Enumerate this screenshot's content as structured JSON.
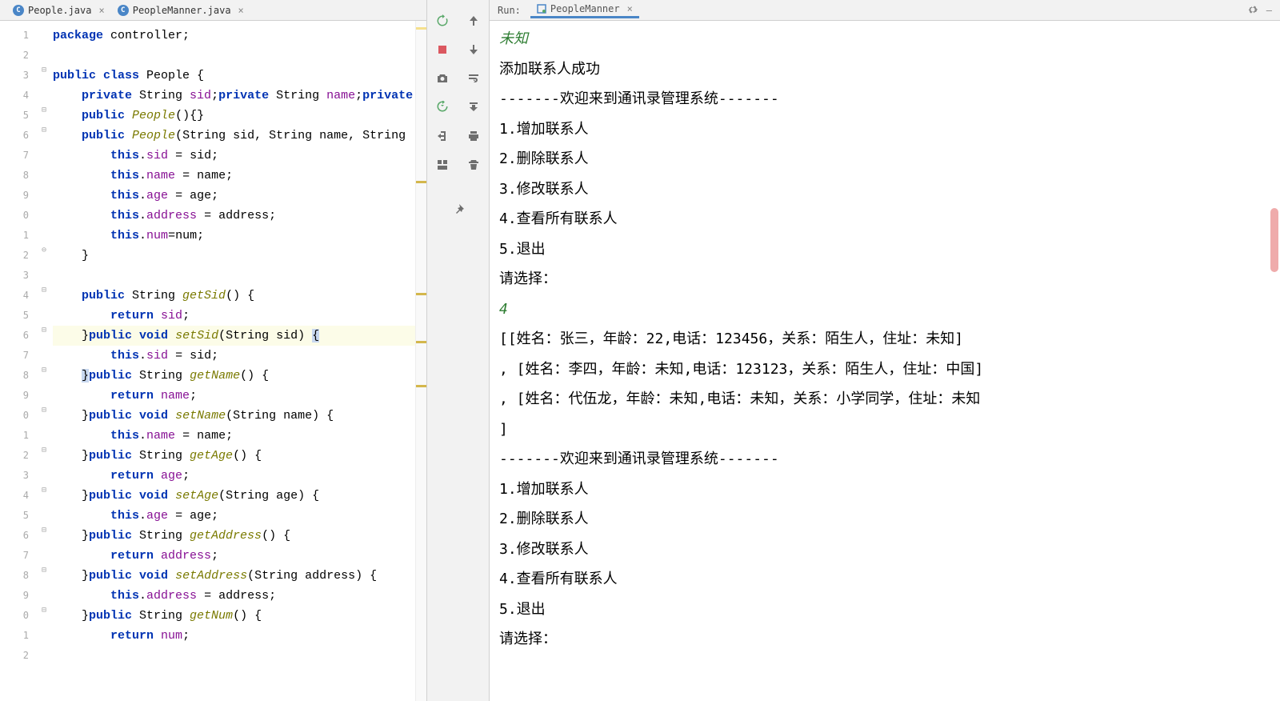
{
  "editor": {
    "tabs": [
      {
        "label": "People.java"
      },
      {
        "label": "PeopleManner.java"
      }
    ],
    "gutter": [
      "1",
      "2",
      "3",
      "4",
      "5",
      "6",
      "7",
      "8",
      "9",
      "0",
      "1",
      "2",
      "3",
      "4",
      "5",
      "6",
      "7",
      "8",
      "9",
      "0",
      "1",
      "2",
      "3",
      "4",
      "5",
      "6",
      "7",
      "8",
      "9",
      "0",
      "1",
      "2"
    ],
    "code_tokens": {
      "l1": {
        "kw1": "package",
        "plain": " controller;"
      },
      "l3": {
        "kw1": "public",
        "kw2": "class",
        "plain": " People {"
      },
      "l4": {
        "kw1": "private",
        "t1": " String ",
        "f1": "sid",
        "s1": ";",
        "kw2": "private",
        "t2": " String ",
        "f2": "name",
        "s2": ";",
        "kw3": "private"
      },
      "l5": {
        "kw1": "public",
        "m": "People",
        "plain": "(){}"
      },
      "l6": {
        "kw1": "public",
        "m": "People",
        "params": "(String sid, String name, String"
      },
      "l7": {
        "kw": "this",
        "f": "sid",
        "plain": " = sid;"
      },
      "l8": {
        "kw": "this",
        "f": "name",
        "plain": " = name;"
      },
      "l9": {
        "kw": "this",
        "f": "age",
        "plain": " = age;"
      },
      "l10": {
        "kw": "this",
        "f": "address",
        "plain": " = address;"
      },
      "l11": {
        "kw": "this",
        "f": "num",
        "plain": "=num;"
      },
      "l12": {
        "plain": "}"
      },
      "l14": {
        "kw1": "public",
        "t": " String ",
        "m": "getSid",
        "plain": "() {"
      },
      "l15": {
        "kw": "return",
        "f": "sid",
        "plain": ";"
      },
      "l16a": {
        "plain1": "}",
        "kw1": "public",
        "kw2": "void",
        "m": "setSid",
        "params": "(String sid) ",
        "brace": "{"
      },
      "l17": {
        "kw": "this",
        "f": "sid",
        "plain": " = sid;"
      },
      "l18": {
        "brace": "}",
        "kw1": "public",
        "t": " String ",
        "m": "getName",
        "plain": "() {"
      },
      "l19": {
        "kw": "return",
        "f": "name",
        "plain": ";"
      },
      "l20": {
        "plain1": "}",
        "kw1": "public",
        "kw2": "void",
        "m": "setName",
        "params": "(String name) {"
      },
      "l21": {
        "kw": "this",
        "f": "name",
        "plain": " = name;"
      },
      "l22": {
        "plain1": "}",
        "kw1": "public",
        "t": " String ",
        "m": "getAge",
        "plain": "() {"
      },
      "l23": {
        "kw": "return",
        "f": "age",
        "plain": ";"
      },
      "l24": {
        "plain1": "}",
        "kw1": "public",
        "kw2": "void",
        "m": "setAge",
        "params": "(String age) {"
      },
      "l25": {
        "kw": "this",
        "f": "age",
        "plain": " = age;"
      },
      "l26": {
        "plain1": "}",
        "kw1": "public",
        "t": " String ",
        "m": "getAddress",
        "plain": "() {"
      },
      "l27": {
        "kw": "return",
        "f": "address",
        "plain": ";"
      },
      "l28": {
        "plain1": "}",
        "kw1": "public",
        "kw2": "void",
        "m": "setAddress",
        "params": "(String address) {"
      },
      "l29": {
        "kw": "this",
        "f": "address",
        "plain": " = address;"
      },
      "l30": {
        "plain1": "}",
        "kw1": "public",
        "t": " String ",
        "m": "getNum",
        "plain": "() {"
      },
      "l31": {
        "kw": "return",
        "f": "num",
        "plain": ";"
      }
    }
  },
  "run": {
    "header_label": "Run:",
    "tab_label": "PeopleManner",
    "lines": [
      {
        "text": "未知",
        "cls": "italic-green"
      },
      {
        "text": "添加联系人成功"
      },
      {
        "text": "-------欢迎来到通讯录管理系统-------"
      },
      {
        "text": "1.增加联系人"
      },
      {
        "text": "2.删除联系人"
      },
      {
        "text": "3.修改联系人"
      },
      {
        "text": "4.查看所有联系人"
      },
      {
        "text": "5.退出"
      },
      {
        "text": "请选择："
      },
      {
        "text": "4",
        "cls": "input-green"
      },
      {
        "text": "[[姓名：张三，年龄：22,电话：123456，关系：陌生人，住址：未知]"
      },
      {
        "text": ", [姓名：李四，年龄：未知,电话：123123，关系：陌生人，住址：中国]"
      },
      {
        "text": ", [姓名：代伍龙，年龄：未知,电话：未知，关系：小学同学，住址：未知"
      },
      {
        "text": "]"
      },
      {
        "text": "-------欢迎来到通讯录管理系统-------"
      },
      {
        "text": "1.增加联系人"
      },
      {
        "text": "2.删除联系人"
      },
      {
        "text": "3.修改联系人"
      },
      {
        "text": "4.查看所有联系人"
      },
      {
        "text": "5.退出"
      },
      {
        "text": "请选择："
      }
    ]
  }
}
